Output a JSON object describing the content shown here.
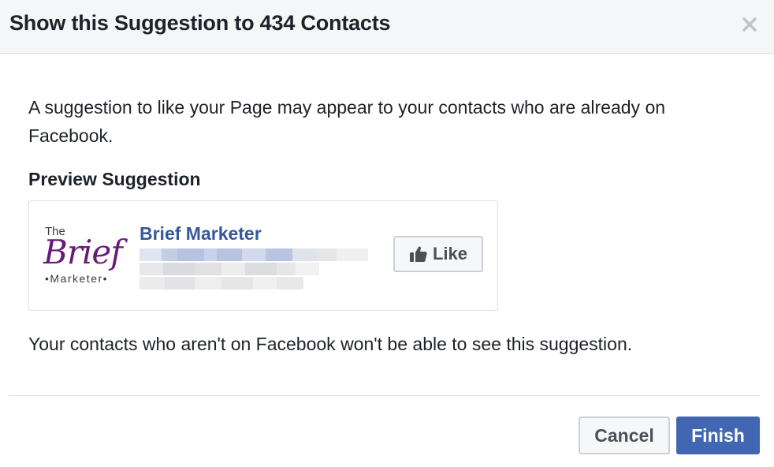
{
  "dialog": {
    "title": "Show this Suggestion to 434 Contacts",
    "close_icon": "close-icon"
  },
  "content": {
    "intro": "A suggestion to like your Page may appear to your contacts who are already on Facebook.",
    "preview_title": "Preview Suggestion",
    "outro": "Your contacts who aren't on Facebook won't be able to see this suggestion."
  },
  "card": {
    "logo": {
      "the": "The",
      "brief": "Brief",
      "marketer": "•Marketer•"
    },
    "page_name": "Brief Marketer",
    "like_label": "Like",
    "like_icon": "thumbs-up-icon"
  },
  "footer": {
    "cancel_label": "Cancel",
    "finish_label": "Finish"
  },
  "colors": {
    "link": "#365899",
    "primary": "#4267b2",
    "logo_purple": "#6a1b7a"
  }
}
